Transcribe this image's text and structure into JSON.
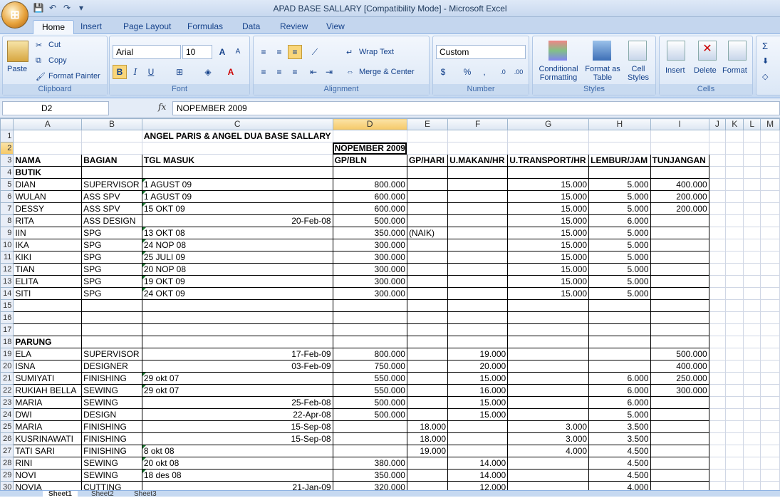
{
  "window": {
    "title": "APAD BASE SALLARY  [Compatibility Mode] - Microsoft Excel"
  },
  "tabs": [
    "Home",
    "Insert",
    "Page Layout",
    "Formulas",
    "Data",
    "Review",
    "View"
  ],
  "ribbon": {
    "clipboard": {
      "paste": "Paste",
      "cut": "Cut",
      "copy": "Copy",
      "format_painter": "Format Painter",
      "label": "Clipboard"
    },
    "font": {
      "name": "Arial",
      "size": "10",
      "label": "Font"
    },
    "alignment": {
      "wrap": "Wrap Text",
      "merge": "Merge & Center",
      "label": "Alignment"
    },
    "number": {
      "format": "Custom",
      "label": "Number"
    },
    "styles": {
      "conditional": "Conditional Formatting",
      "format_table": "Format as Table",
      "cell_styles": "Cell Styles",
      "label": "Styles"
    },
    "cells": {
      "insert": "Insert",
      "delete": "Delete",
      "format": "Format",
      "label": "Cells"
    }
  },
  "formula_bar": {
    "name_box": "D2",
    "fx": "fx",
    "value": "NOPEMBER 2009"
  },
  "columns": [
    "A",
    "B",
    "C",
    "D",
    "E",
    "F",
    "G",
    "H",
    "I",
    "J",
    "K",
    "L",
    "M"
  ],
  "rows": [
    {
      "n": "1",
      "c": [
        "",
        "",
        "ANGEL PARIS & ANGEL DUA BASE SALLARY",
        "",
        "",
        "",
        "",
        "",
        "",
        "",
        "",
        "",
        ""
      ]
    },
    {
      "n": "2",
      "c": [
        "",
        "",
        "",
        "NOPEMBER 2009",
        "",
        "",
        "",
        "",
        "",
        "",
        "",
        "",
        ""
      ]
    },
    {
      "n": "3",
      "c": [
        "NAMA",
        "BAGIAN",
        "TGL MASUK",
        "GP/BLN",
        "GP/HARI",
        "U.MAKAN/HR",
        "U.TRANSPORT/HR",
        "LEMBUR/JAM",
        "TUNJANGAN",
        "",
        "",
        "",
        ""
      ]
    },
    {
      "n": "4",
      "c": [
        "BUTIK",
        "",
        "",
        "",
        "",
        "",
        "",
        "",
        "",
        "",
        "",
        "",
        ""
      ]
    },
    {
      "n": "5",
      "c": [
        "DIAN",
        "SUPERVISOR",
        "1 AGUST 09",
        "800.000",
        "",
        "",
        "15.000",
        "5.000",
        "400.000",
        "",
        "",
        "",
        ""
      ]
    },
    {
      "n": "6",
      "c": [
        "WULAN",
        "ASS SPV",
        "1 AGUST 09",
        "600.000",
        "",
        "",
        "15.000",
        "5.000",
        "200.000",
        "",
        "",
        "",
        ""
      ]
    },
    {
      "n": "7",
      "c": [
        "DESSY",
        "ASS SPV",
        "15 OKT 09",
        "600.000",
        "",
        "",
        "15.000",
        "5.000",
        "200.000",
        "",
        "",
        "",
        ""
      ]
    },
    {
      "n": "8",
      "c": [
        "RITA",
        "ASS DESIGN",
        "20-Feb-08",
        "500.000",
        "",
        "",
        "15.000",
        "6.000",
        "",
        "",
        "",
        "",
        ""
      ]
    },
    {
      "n": "9",
      "c": [
        "IIN",
        "SPG",
        "13 OKT 08",
        "350.000",
        "(NAIK)",
        "",
        "15.000",
        "5.000",
        "",
        "",
        "",
        "",
        ""
      ]
    },
    {
      "n": "10",
      "c": [
        "IKA",
        "SPG",
        "24 NOP 08",
        "300.000",
        "",
        "",
        "15.000",
        "5.000",
        "",
        "",
        "",
        "",
        ""
      ]
    },
    {
      "n": "11",
      "c": [
        "KIKI",
        "SPG",
        "25 JULI 09",
        "300.000",
        "",
        "",
        "15.000",
        "5.000",
        "",
        "",
        "",
        "",
        ""
      ]
    },
    {
      "n": "12",
      "c": [
        "TIAN",
        "SPG",
        "20 NOP 08",
        "300.000",
        "",
        "",
        "15.000",
        "5.000",
        "",
        "",
        "",
        "",
        ""
      ]
    },
    {
      "n": "13",
      "c": [
        "ELITA",
        "SPG",
        "19 OKT 09",
        "300.000",
        "",
        "",
        "15.000",
        "5.000",
        "",
        "",
        "",
        "",
        ""
      ]
    },
    {
      "n": "14",
      "c": [
        "SITI",
        "SPG",
        "24 OKT 09",
        "300.000",
        "",
        "",
        "15.000",
        "5.000",
        "",
        "",
        "",
        "",
        ""
      ]
    },
    {
      "n": "15",
      "c": [
        "",
        "",
        "",
        "",
        "",
        "",
        "",
        "",
        "",
        "",
        "",
        "",
        ""
      ]
    },
    {
      "n": "16",
      "c": [
        "",
        "",
        "",
        "",
        "",
        "",
        "",
        "",
        "",
        "",
        "",
        "",
        ""
      ]
    },
    {
      "n": "17",
      "c": [
        "",
        "",
        "",
        "",
        "",
        "",
        "",
        "",
        "",
        "",
        "",
        "",
        ""
      ]
    },
    {
      "n": "18",
      "c": [
        "PARUNG",
        "",
        "",
        "",
        "",
        "",
        "",
        "",
        "",
        "",
        "",
        "",
        ""
      ]
    },
    {
      "n": "19",
      "c": [
        "ELA",
        "SUPERVISOR",
        "17-Feb-09",
        "800.000",
        "",
        "19.000",
        "",
        "",
        "500.000",
        "",
        "",
        "",
        ""
      ]
    },
    {
      "n": "20",
      "c": [
        "ISNA",
        "DESIGNER",
        "03-Feb-09",
        "750.000",
        "",
        "20.000",
        "",
        "",
        "400.000",
        "",
        "",
        "",
        ""
      ]
    },
    {
      "n": "21",
      "c": [
        "SUMIYATI",
        "FINISHING",
        "29 okt 07",
        "550.000",
        "",
        "15.000",
        "",
        "6.000",
        "250.000",
        "",
        "",
        "",
        ""
      ]
    },
    {
      "n": "22",
      "c": [
        "RUKIAH BELLA",
        "SEWING",
        "29 okt 07",
        "550.000",
        "",
        "16.000",
        "",
        "6.000",
        "300.000",
        "",
        "",
        "",
        ""
      ]
    },
    {
      "n": "23",
      "c": [
        "MARIA",
        "SEWING",
        "25-Feb-08",
        "500.000",
        "",
        "15.000",
        "",
        "6.000",
        "",
        "",
        "",
        "",
        ""
      ]
    },
    {
      "n": "24",
      "c": [
        "DWI",
        "DESIGN",
        "22-Apr-08",
        "500.000",
        "",
        "15.000",
        "",
        "5.000",
        "",
        "",
        "",
        "",
        ""
      ]
    },
    {
      "n": "25",
      "c": [
        "MARIA",
        "FINISHING",
        "15-Sep-08",
        "",
        "18.000",
        "",
        "3.000",
        "3.500",
        "",
        "",
        "",
        "",
        ""
      ]
    },
    {
      "n": "26",
      "c": [
        "KUSRINAWATI",
        "FINISHING",
        "15-Sep-08",
        "",
        "18.000",
        "",
        "3.000",
        "3.500",
        "",
        "",
        "",
        "",
        ""
      ]
    },
    {
      "n": "27",
      "c": [
        "TATI SARI",
        "FINISHING",
        "8 okt 08",
        "",
        "19.000",
        "",
        "4.000",
        "4.500",
        "",
        "",
        "",
        "",
        ""
      ]
    },
    {
      "n": "28",
      "c": [
        "RINI",
        "SEWING",
        "20 okt 08",
        "380.000",
        "",
        "14.000",
        "",
        "4.500",
        "",
        "",
        "",
        "",
        ""
      ]
    },
    {
      "n": "29",
      "c": [
        "NOVI",
        "SEWING",
        "18 des 08",
        "350.000",
        "",
        "14.000",
        "",
        "4.500",
        "",
        "",
        "",
        "",
        ""
      ]
    },
    {
      "n": "30",
      "c": [
        "NOVIA",
        "CUTTING",
        "21-Jan-09",
        "320.000",
        "",
        "12.000",
        "",
        "4.000",
        "",
        "",
        "",
        "",
        ""
      ]
    }
  ],
  "sheets": [
    "Sheet1",
    "Sheet2",
    "Sheet3"
  ]
}
